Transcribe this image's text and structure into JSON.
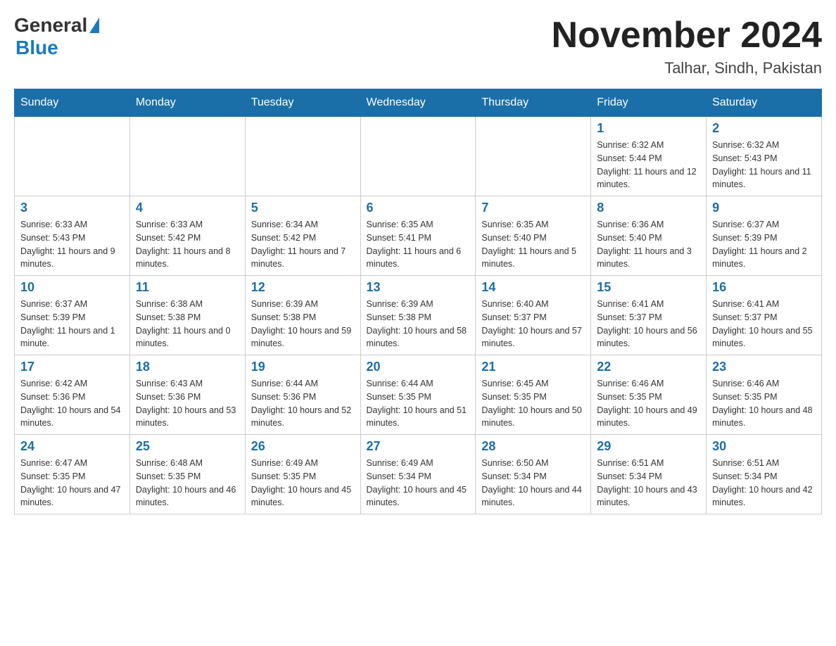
{
  "header": {
    "logo_general": "General",
    "logo_blue": "Blue",
    "month_year": "November 2024",
    "location": "Talhar, Sindh, Pakistan"
  },
  "days_of_week": [
    "Sunday",
    "Monday",
    "Tuesday",
    "Wednesday",
    "Thursday",
    "Friday",
    "Saturday"
  ],
  "weeks": [
    [
      {
        "day": "",
        "info": ""
      },
      {
        "day": "",
        "info": ""
      },
      {
        "day": "",
        "info": ""
      },
      {
        "day": "",
        "info": ""
      },
      {
        "day": "",
        "info": ""
      },
      {
        "day": "1",
        "info": "Sunrise: 6:32 AM\nSunset: 5:44 PM\nDaylight: 11 hours and 12 minutes."
      },
      {
        "day": "2",
        "info": "Sunrise: 6:32 AM\nSunset: 5:43 PM\nDaylight: 11 hours and 11 minutes."
      }
    ],
    [
      {
        "day": "3",
        "info": "Sunrise: 6:33 AM\nSunset: 5:43 PM\nDaylight: 11 hours and 9 minutes."
      },
      {
        "day": "4",
        "info": "Sunrise: 6:33 AM\nSunset: 5:42 PM\nDaylight: 11 hours and 8 minutes."
      },
      {
        "day": "5",
        "info": "Sunrise: 6:34 AM\nSunset: 5:42 PM\nDaylight: 11 hours and 7 minutes."
      },
      {
        "day": "6",
        "info": "Sunrise: 6:35 AM\nSunset: 5:41 PM\nDaylight: 11 hours and 6 minutes."
      },
      {
        "day": "7",
        "info": "Sunrise: 6:35 AM\nSunset: 5:40 PM\nDaylight: 11 hours and 5 minutes."
      },
      {
        "day": "8",
        "info": "Sunrise: 6:36 AM\nSunset: 5:40 PM\nDaylight: 11 hours and 3 minutes."
      },
      {
        "day": "9",
        "info": "Sunrise: 6:37 AM\nSunset: 5:39 PM\nDaylight: 11 hours and 2 minutes."
      }
    ],
    [
      {
        "day": "10",
        "info": "Sunrise: 6:37 AM\nSunset: 5:39 PM\nDaylight: 11 hours and 1 minute."
      },
      {
        "day": "11",
        "info": "Sunrise: 6:38 AM\nSunset: 5:38 PM\nDaylight: 11 hours and 0 minutes."
      },
      {
        "day": "12",
        "info": "Sunrise: 6:39 AM\nSunset: 5:38 PM\nDaylight: 10 hours and 59 minutes."
      },
      {
        "day": "13",
        "info": "Sunrise: 6:39 AM\nSunset: 5:38 PM\nDaylight: 10 hours and 58 minutes."
      },
      {
        "day": "14",
        "info": "Sunrise: 6:40 AM\nSunset: 5:37 PM\nDaylight: 10 hours and 57 minutes."
      },
      {
        "day": "15",
        "info": "Sunrise: 6:41 AM\nSunset: 5:37 PM\nDaylight: 10 hours and 56 minutes."
      },
      {
        "day": "16",
        "info": "Sunrise: 6:41 AM\nSunset: 5:37 PM\nDaylight: 10 hours and 55 minutes."
      }
    ],
    [
      {
        "day": "17",
        "info": "Sunrise: 6:42 AM\nSunset: 5:36 PM\nDaylight: 10 hours and 54 minutes."
      },
      {
        "day": "18",
        "info": "Sunrise: 6:43 AM\nSunset: 5:36 PM\nDaylight: 10 hours and 53 minutes."
      },
      {
        "day": "19",
        "info": "Sunrise: 6:44 AM\nSunset: 5:36 PM\nDaylight: 10 hours and 52 minutes."
      },
      {
        "day": "20",
        "info": "Sunrise: 6:44 AM\nSunset: 5:35 PM\nDaylight: 10 hours and 51 minutes."
      },
      {
        "day": "21",
        "info": "Sunrise: 6:45 AM\nSunset: 5:35 PM\nDaylight: 10 hours and 50 minutes."
      },
      {
        "day": "22",
        "info": "Sunrise: 6:46 AM\nSunset: 5:35 PM\nDaylight: 10 hours and 49 minutes."
      },
      {
        "day": "23",
        "info": "Sunrise: 6:46 AM\nSunset: 5:35 PM\nDaylight: 10 hours and 48 minutes."
      }
    ],
    [
      {
        "day": "24",
        "info": "Sunrise: 6:47 AM\nSunset: 5:35 PM\nDaylight: 10 hours and 47 minutes."
      },
      {
        "day": "25",
        "info": "Sunrise: 6:48 AM\nSunset: 5:35 PM\nDaylight: 10 hours and 46 minutes."
      },
      {
        "day": "26",
        "info": "Sunrise: 6:49 AM\nSunset: 5:35 PM\nDaylight: 10 hours and 45 minutes."
      },
      {
        "day": "27",
        "info": "Sunrise: 6:49 AM\nSunset: 5:34 PM\nDaylight: 10 hours and 45 minutes."
      },
      {
        "day": "28",
        "info": "Sunrise: 6:50 AM\nSunset: 5:34 PM\nDaylight: 10 hours and 44 minutes."
      },
      {
        "day": "29",
        "info": "Sunrise: 6:51 AM\nSunset: 5:34 PM\nDaylight: 10 hours and 43 minutes."
      },
      {
        "day": "30",
        "info": "Sunrise: 6:51 AM\nSunset: 5:34 PM\nDaylight: 10 hours and 42 minutes."
      }
    ]
  ]
}
